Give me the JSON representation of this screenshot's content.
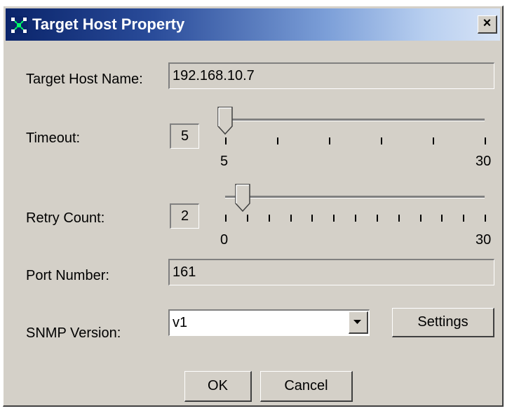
{
  "window": {
    "title": "Target Host Property",
    "close_glyph": "×"
  },
  "fields": {
    "host_name": {
      "label": "Target Host Name:",
      "value": "192.168.10.7"
    },
    "timeout": {
      "label": "Timeout:",
      "value": "5",
      "min": "5",
      "max": "30",
      "slider_fraction": 0.0
    },
    "retry": {
      "label": "Retry Count:",
      "value": "2",
      "min": "0",
      "max": "30",
      "slider_fraction": 0.067
    },
    "port": {
      "label": "Port Number:",
      "value": "161"
    },
    "snmp": {
      "label": "SNMP Version:",
      "selected": "v1"
    }
  },
  "buttons": {
    "settings": "Settings",
    "ok": "OK",
    "cancel": "Cancel"
  },
  "icons": {
    "app": "network-icon",
    "close": "close-icon",
    "dropdown": "chevron-down-icon"
  }
}
